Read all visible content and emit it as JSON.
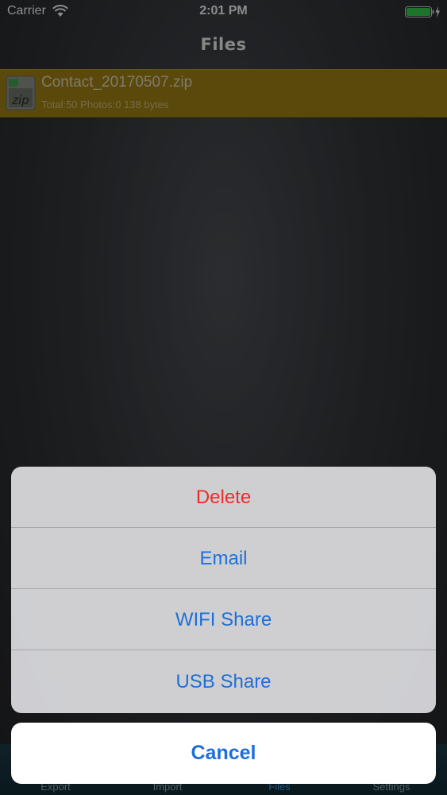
{
  "status_bar": {
    "carrier": "Carrier",
    "time": "2:01 PM",
    "battery_color": "#33c84a"
  },
  "nav": {
    "title": "Files"
  },
  "files": [
    {
      "name": "Contact_20170507.zip",
      "meta": "Total:50 Photos:0   138 bytes",
      "icon": "zip-file-icon"
    }
  ],
  "tab_bar": {
    "tabs": [
      {
        "label": "Export"
      },
      {
        "label": "Import"
      },
      {
        "label": "Files"
      },
      {
        "label": "Settings"
      }
    ]
  },
  "action_sheet": {
    "delete_label": "Delete",
    "email_label": "Email",
    "wifi_share_label": "WIFI Share",
    "usb_share_label": "USB Share",
    "cancel_label": "Cancel"
  },
  "colors": {
    "destructive": "#ef2b2b",
    "action": "#1e6fd9",
    "selected_row": "#9d7e14"
  }
}
